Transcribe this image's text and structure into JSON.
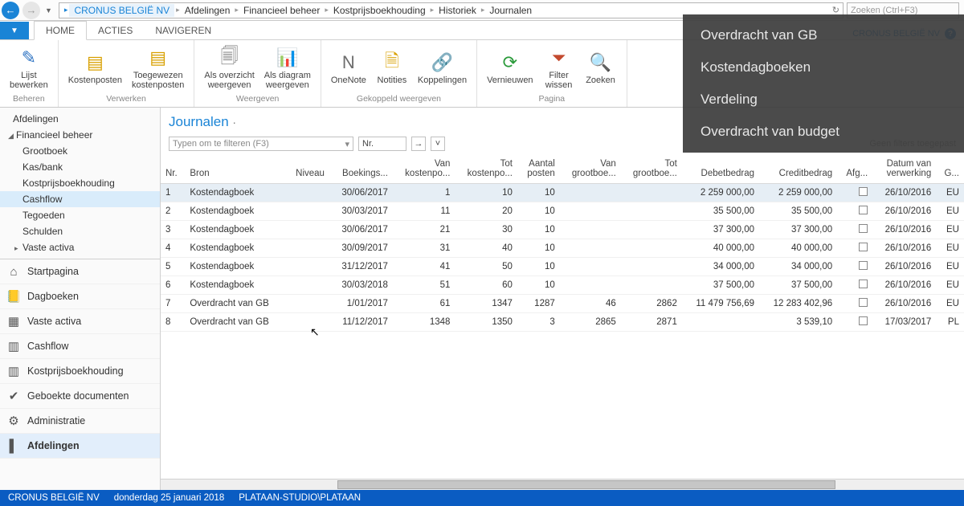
{
  "breadcrumb": {
    "company": "CRONUS BELGIË NV",
    "items": [
      "Afdelingen",
      "Financieel beheer",
      "Kostprijsboekhouding",
      "Historiek",
      "Journalen"
    ]
  },
  "search_placeholder": "Zoeken (Ctrl+F3)",
  "company_label": "CRONUS BELGIË NV",
  "ribbon": {
    "tabs": [
      "HOME",
      "ACTIES",
      "NAVIGEREN"
    ],
    "groups": [
      {
        "caption": "Beheren",
        "buttons": [
          {
            "icon": "✎",
            "cls": "b",
            "label": "Lijst\nbewerken"
          }
        ]
      },
      {
        "caption": "Verwerken",
        "buttons": [
          {
            "icon": "▤",
            "cls": "y",
            "label": "Kostenposten"
          },
          {
            "icon": "▤",
            "cls": "y",
            "label": "Toegewezen\nkostenposten"
          }
        ]
      },
      {
        "caption": "Weergeven",
        "buttons": [
          {
            "icon": "🗐",
            "cls": "",
            "label": "Als overzicht\nweergeven"
          },
          {
            "icon": "📊",
            "cls": "b",
            "label": "Als diagram\nweergeven"
          }
        ]
      },
      {
        "caption": "Gekoppeld weergeven",
        "buttons": [
          {
            "icon": "N",
            "cls": "",
            "label": "OneNote"
          },
          {
            "icon": "🗎",
            "cls": "y",
            "label": "Notities"
          },
          {
            "icon": "🔗",
            "cls": "",
            "label": "Koppelingen"
          }
        ]
      },
      {
        "caption": "Pagina",
        "buttons": [
          {
            "icon": "⟳",
            "cls": "g",
            "label": "Vernieuwen"
          },
          {
            "icon": "⏷",
            "cls": "r",
            "label": "Filter\nwissen"
          },
          {
            "icon": "🔍",
            "cls": "",
            "label": "Zoeken"
          }
        ]
      }
    ]
  },
  "tree": {
    "root": "Afdelingen",
    "parent": "Financieel beheer",
    "items": [
      "Grootboek",
      "Kas/bank",
      "Kostprijsboekhouding",
      "Cashflow",
      "Tegoeden",
      "Schulden",
      "Vaste activa"
    ],
    "selected": "Cashflow"
  },
  "nav": [
    {
      "icon": "⌂",
      "label": "Startpagina"
    },
    {
      "icon": "📒",
      "label": "Dagboeken"
    },
    {
      "icon": "▦",
      "label": "Vaste activa"
    },
    {
      "icon": "▥",
      "label": "Cashflow"
    },
    {
      "icon": "▥",
      "label": "Kostprijsboekhouding"
    },
    {
      "icon": "✔",
      "label": "Geboekte documenten"
    },
    {
      "icon": "⚙",
      "label": "Administratie"
    },
    {
      "icon": "▌",
      "label": "Afdelingen"
    }
  ],
  "nav_selected": "Afdelingen",
  "page_title": "Journalen",
  "filter_type_placeholder": "Typen om te filteren (F3)",
  "filter_field": "Nr.",
  "no_filters": "Geen filters toegepast",
  "columns": [
    "Nr.",
    "Bron",
    "Niveau",
    "Boekings...",
    "Van\nkostenpo...",
    "Tot\nkostenpo...",
    "Aantal\nposten",
    "Van\ngrootboe...",
    "Tot\ngrootboe...",
    "Debetbedrag",
    "Creditbedrag",
    "Afg...",
    "Datum van\nverwerking",
    "G..."
  ],
  "rows": [
    {
      "nr": 1,
      "bron": "Kostendagboek",
      "boek": "30/06/2017",
      "van_k": 1,
      "tot_k": 10,
      "aant": 10,
      "van_g": "",
      "tot_g": "",
      "debet": "2 259 000,00",
      "credit": "2 259 000,00",
      "datum": "26/10/2016",
      "g": "EU"
    },
    {
      "nr": 2,
      "bron": "Kostendagboek",
      "boek": "30/03/2017",
      "van_k": 11,
      "tot_k": 20,
      "aant": 10,
      "van_g": "",
      "tot_g": "",
      "debet": "35 500,00",
      "credit": "35 500,00",
      "datum": "26/10/2016",
      "g": "EU"
    },
    {
      "nr": 3,
      "bron": "Kostendagboek",
      "boek": "30/06/2017",
      "van_k": 21,
      "tot_k": 30,
      "aant": 10,
      "van_g": "",
      "tot_g": "",
      "debet": "37 300,00",
      "credit": "37 300,00",
      "datum": "26/10/2016",
      "g": "EU"
    },
    {
      "nr": 4,
      "bron": "Kostendagboek",
      "boek": "30/09/2017",
      "van_k": 31,
      "tot_k": 40,
      "aant": 10,
      "van_g": "",
      "tot_g": "",
      "debet": "40 000,00",
      "credit": "40 000,00",
      "datum": "26/10/2016",
      "g": "EU"
    },
    {
      "nr": 5,
      "bron": "Kostendagboek",
      "boek": "31/12/2017",
      "van_k": 41,
      "tot_k": 50,
      "aant": 10,
      "van_g": "",
      "tot_g": "",
      "debet": "34 000,00",
      "credit": "34 000,00",
      "datum": "26/10/2016",
      "g": "EU"
    },
    {
      "nr": 6,
      "bron": "Kostendagboek",
      "boek": "30/03/2018",
      "van_k": 51,
      "tot_k": 60,
      "aant": 10,
      "van_g": "",
      "tot_g": "",
      "debet": "37 500,00",
      "credit": "37 500,00",
      "datum": "26/10/2016",
      "g": "EU"
    },
    {
      "nr": 7,
      "bron": "Overdracht van GB",
      "boek": "1/01/2017",
      "van_k": 61,
      "tot_k": 1347,
      "aant": 1287,
      "van_g": 46,
      "tot_g": 2862,
      "debet": "11 479 756,69",
      "credit": "12 283 402,96",
      "datum": "26/10/2016",
      "g": "EU"
    },
    {
      "nr": 8,
      "bron": "Overdracht van GB",
      "boek": "11/12/2017",
      "van_k": 1348,
      "tot_k": 1350,
      "aant": 3,
      "van_g": 2865,
      "tot_g": 2871,
      "debet": "",
      "credit": "3 539,10",
      "datum": "17/03/2017",
      "g": "PL"
    }
  ],
  "floatmenu": [
    "Overdracht van GB",
    "Kostendagboeken",
    "Verdeling",
    "Overdracht van budget"
  ],
  "status": {
    "company": "CRONUS BELGIË NV",
    "date": "donderdag 25 januari 2018",
    "user": "PLATAAN-STUDIO\\PLATAAN"
  }
}
